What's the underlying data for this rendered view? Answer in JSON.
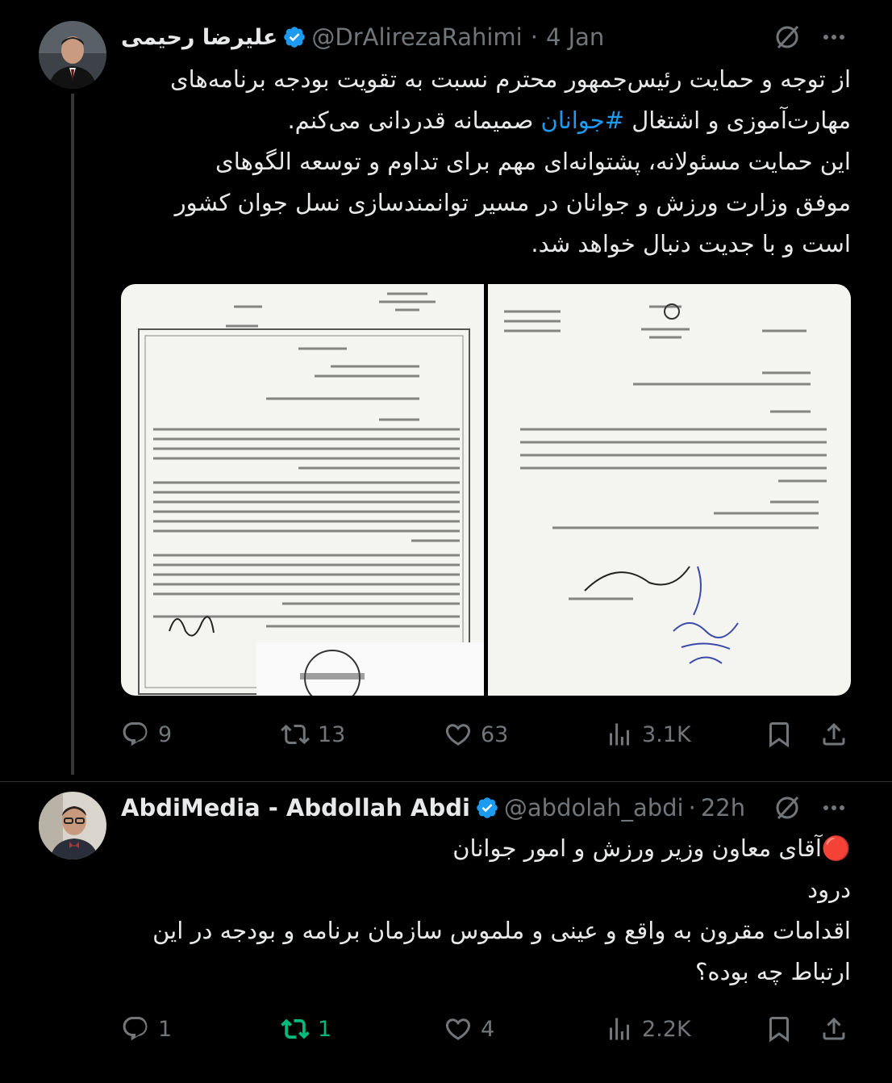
{
  "colors": {
    "accent": "#1d9bf0",
    "repost_active": "#00ba7c",
    "muted": "#71767b",
    "bg": "#000000"
  },
  "tweet1": {
    "author_name": "علیرضا رحیمی",
    "handle": "@DrAlirezaRahimi",
    "dot": "·",
    "time": "4 Jan",
    "text_lines": [
      "از توجه و حمایت رئیس‌جمهور محترم نسبت به تقویت بودجه برنامه‌های",
      "این حمایت مسئولانه، پشتوانه‌ای مهم برای تداوم و توسعه الگوهای",
      "موفق وزارت ورزش و جوانان در مسیر توانمندسازی نسل جوان کشور",
      "است و با جدیت دنبال خواهد شد."
    ],
    "line2_before": "مهارت‌آموزی و اشتغال ",
    "hashtag": "#جوانان",
    "line2_after": " صمیمانه قدردانی می‌کنم.",
    "counts": {
      "replies": "9",
      "reposts": "13",
      "likes": "63",
      "views": "3.1K"
    },
    "icons": [
      "grok-icon",
      "more-icon",
      "reply-icon",
      "repost-icon",
      "like-icon",
      "views-icon",
      "bookmark-icon",
      "share-icon",
      "verified-icon"
    ]
  },
  "tweet2": {
    "author_name": "AbdiMedia - Abdollah Abdi",
    "handle": "@abdolah_abdi",
    "dot": "·",
    "time": "22h",
    "emoji": "🔴",
    "text_lines": [
      "آقای معاون وزیر ورزش و امور جوانان",
      "درود",
      "اقدامات مقرون به واقع و عینی و ملموس سازمان برنامه و بودجه در این",
      "ارتباط چه بوده؟"
    ],
    "counts": {
      "replies": "1",
      "reposts": "1",
      "likes": "4",
      "views": "2.2K"
    }
  }
}
